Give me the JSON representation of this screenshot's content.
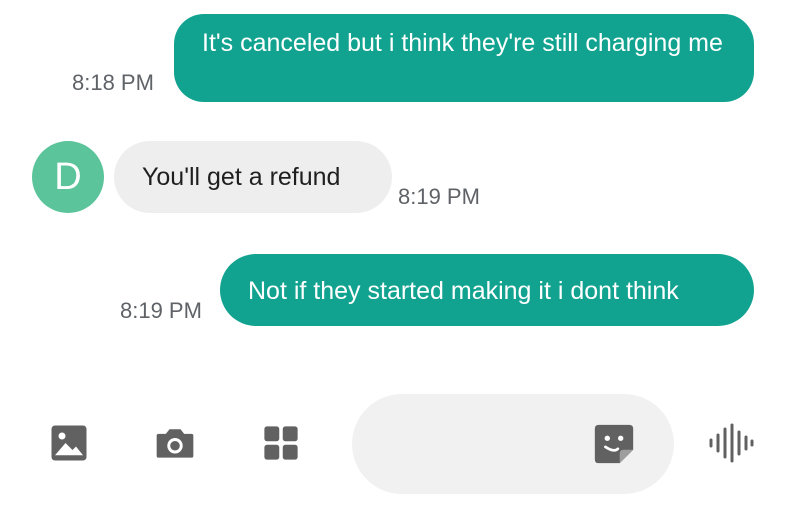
{
  "conversation": {
    "messages": [
      {
        "direction": "outgoing",
        "text": "It's canceled but i think they're still charging me",
        "time": "8:18 PM"
      },
      {
        "direction": "incoming",
        "sender_initial": "D",
        "text": "You'll get a refund",
        "time": "8:19 PM"
      },
      {
        "direction": "outgoing",
        "text": "Not if they started making it i dont think",
        "time": "8:19 PM"
      }
    ]
  },
  "composer": {
    "icons": [
      "gallery-icon",
      "camera-icon",
      "apps-grid-icon",
      "sticker-icon",
      "voice-waveform-icon"
    ],
    "placeholder": ""
  },
  "colors": {
    "outgoing_bubble": "#12a390",
    "incoming_bubble": "#eeeeee",
    "avatar": "#5cc49b",
    "icon": "#616161"
  }
}
